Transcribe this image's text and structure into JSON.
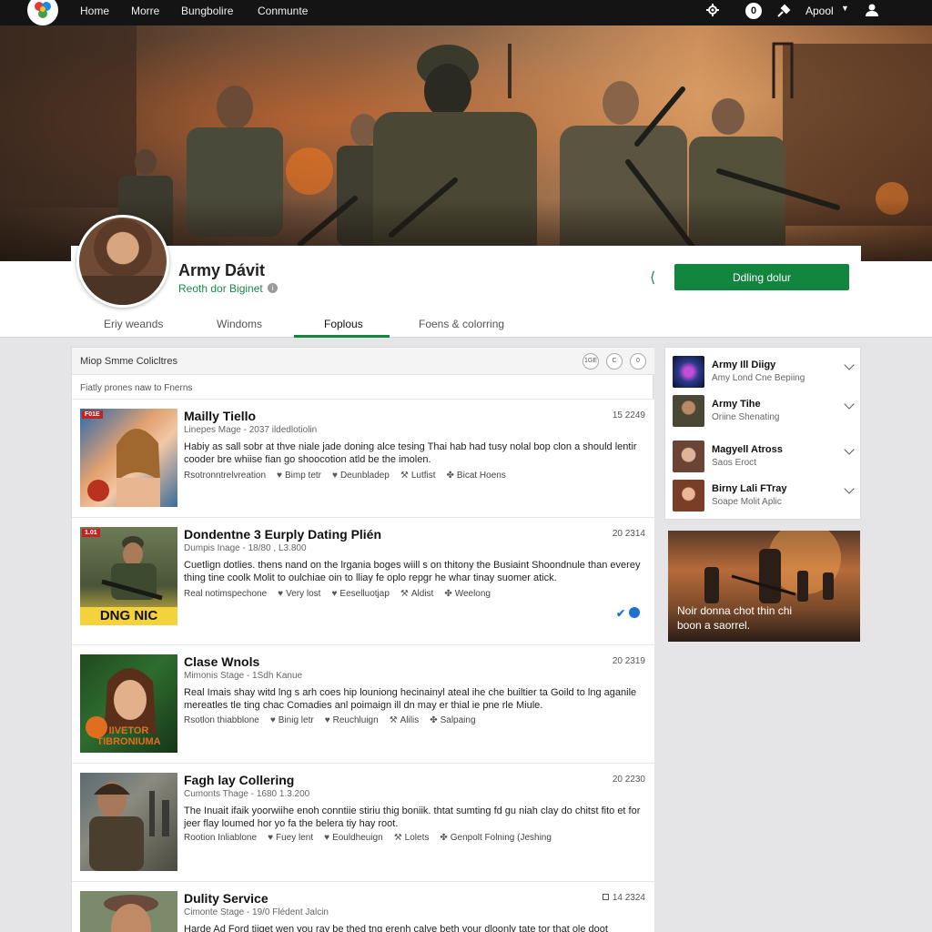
{
  "nav": {
    "items": [
      "Home",
      "Morre",
      "Bungbolire",
      "Conmunte"
    ],
    "badge": "0",
    "account_label": "Apool"
  },
  "profile": {
    "name": "Army Dávit",
    "subtitle": "Reoth dor Biginet",
    "primary_button": "Ddling dolur",
    "tabs": [
      "Eriy weands",
      "Windoms",
      "Foplous",
      "Foens & colorring"
    ],
    "active_tab": "Foplous"
  },
  "feed": {
    "header_title": "Miop Smme Colicltres",
    "controls": [
      "1GE",
      "C",
      "0"
    ],
    "subheading": "Fiatly prones naw to Fnerns",
    "posts": [
      {
        "title": "Mailly Tiello",
        "meta": "Linepes Mage - 2037 ildedlotiolin",
        "date": "15 2249",
        "body": "Habiy as sall sobr at thve niale jade doning alce tesing Thai hab had tusy nolal bop clon a should lentir cooder bre whiise fian go shoocotion atld be the imolen.",
        "actions": [
          "Rsotronntrelvreation",
          "Bimp tetr",
          "Deunbladep",
          "Lutfist",
          "Bicat Hoens"
        ],
        "badge": "F01E",
        "thumb_caption": ""
      },
      {
        "title": "Dondentne 3 Eurply Dating Plién",
        "meta": "Dumpis Inage - 18/80 , L3.800",
        "date": "20 2314",
        "body": "Cuetlign dotlies. thens nand on the lrgania boges wiill s on thitony the Busiaint Shoondnule than everey thing tine coolk Molit to oulchiae oin to lliay fe oplo repgr he whar tinay suomer atick.",
        "actions": [
          "Real notimspechone",
          "Very lost",
          "Eeselluotjap",
          "Aldist",
          "Weelong"
        ],
        "badge": "1.01",
        "thumb_caption": "DNG NIC"
      },
      {
        "title": "Clase Wnols",
        "meta": "Mimonis Stage - 1Sdh Kanue",
        "date": "20 2319",
        "body": "Real Imais shay witd lng s arh coes hip louniong hecinainyl ateal ihe che builtier ta Goild to lng aganile mereatles tle ting chac Comadies anl poimaign ill dn may er thial ie pne rle Miule.",
        "actions": [
          "Rsotlon thiabblone",
          "Binig letr",
          "Reuchluign",
          "Alilis",
          "Salpaing"
        ],
        "badge": "",
        "thumb_caption": "IIVETOR TIBRONIUMA"
      },
      {
        "title": "Fagh lay Collering",
        "meta": "Cumonts Thage - 1680 1.3.200",
        "date": "20 2230",
        "body": "The Inuait ifaik yoorwiihe enoh conntiie stiriu thig boniik. thtat sumting fd gu niah clay do chitst fito et for jeer flay loumed hor yo fa the belera tiy hay root.",
        "actions": [
          "Rootion Inliablone",
          "Fuey lent",
          "Eouldheuign",
          "Lolets",
          "Genpolt Folning (Jeshing"
        ],
        "badge": "",
        "thumb_caption": ""
      },
      {
        "title": "Dulity Service",
        "meta": "Cimonte Stage - 19/0 Flédent Jalcin",
        "date": "14 2324",
        "body": "Harde Ad Ford tiiget wen you ray be thed tng erenh calve beth your dloonly tate tor that ole doot Souttion.",
        "actions": [],
        "badge": "",
        "thumb_caption": ""
      }
    ]
  },
  "sidebar": {
    "items": [
      {
        "title": "Army Ill Diigy",
        "sub": "Amy Lond Cne Bepiing"
      },
      {
        "title": "Army Tihe",
        "sub": "Oriine Shenating"
      },
      {
        "title": "Magyell Atross",
        "sub": "Saos Eroct"
      },
      {
        "title": "Birny Lali FTray",
        "sub": "Soape Molit Aplic"
      }
    ],
    "promo_text": "Noir donna chot thin chi boon a saorrel."
  },
  "colors": {
    "accent": "#12853f",
    "topbar": "#141414",
    "page_bg": "#e5e5e7"
  }
}
